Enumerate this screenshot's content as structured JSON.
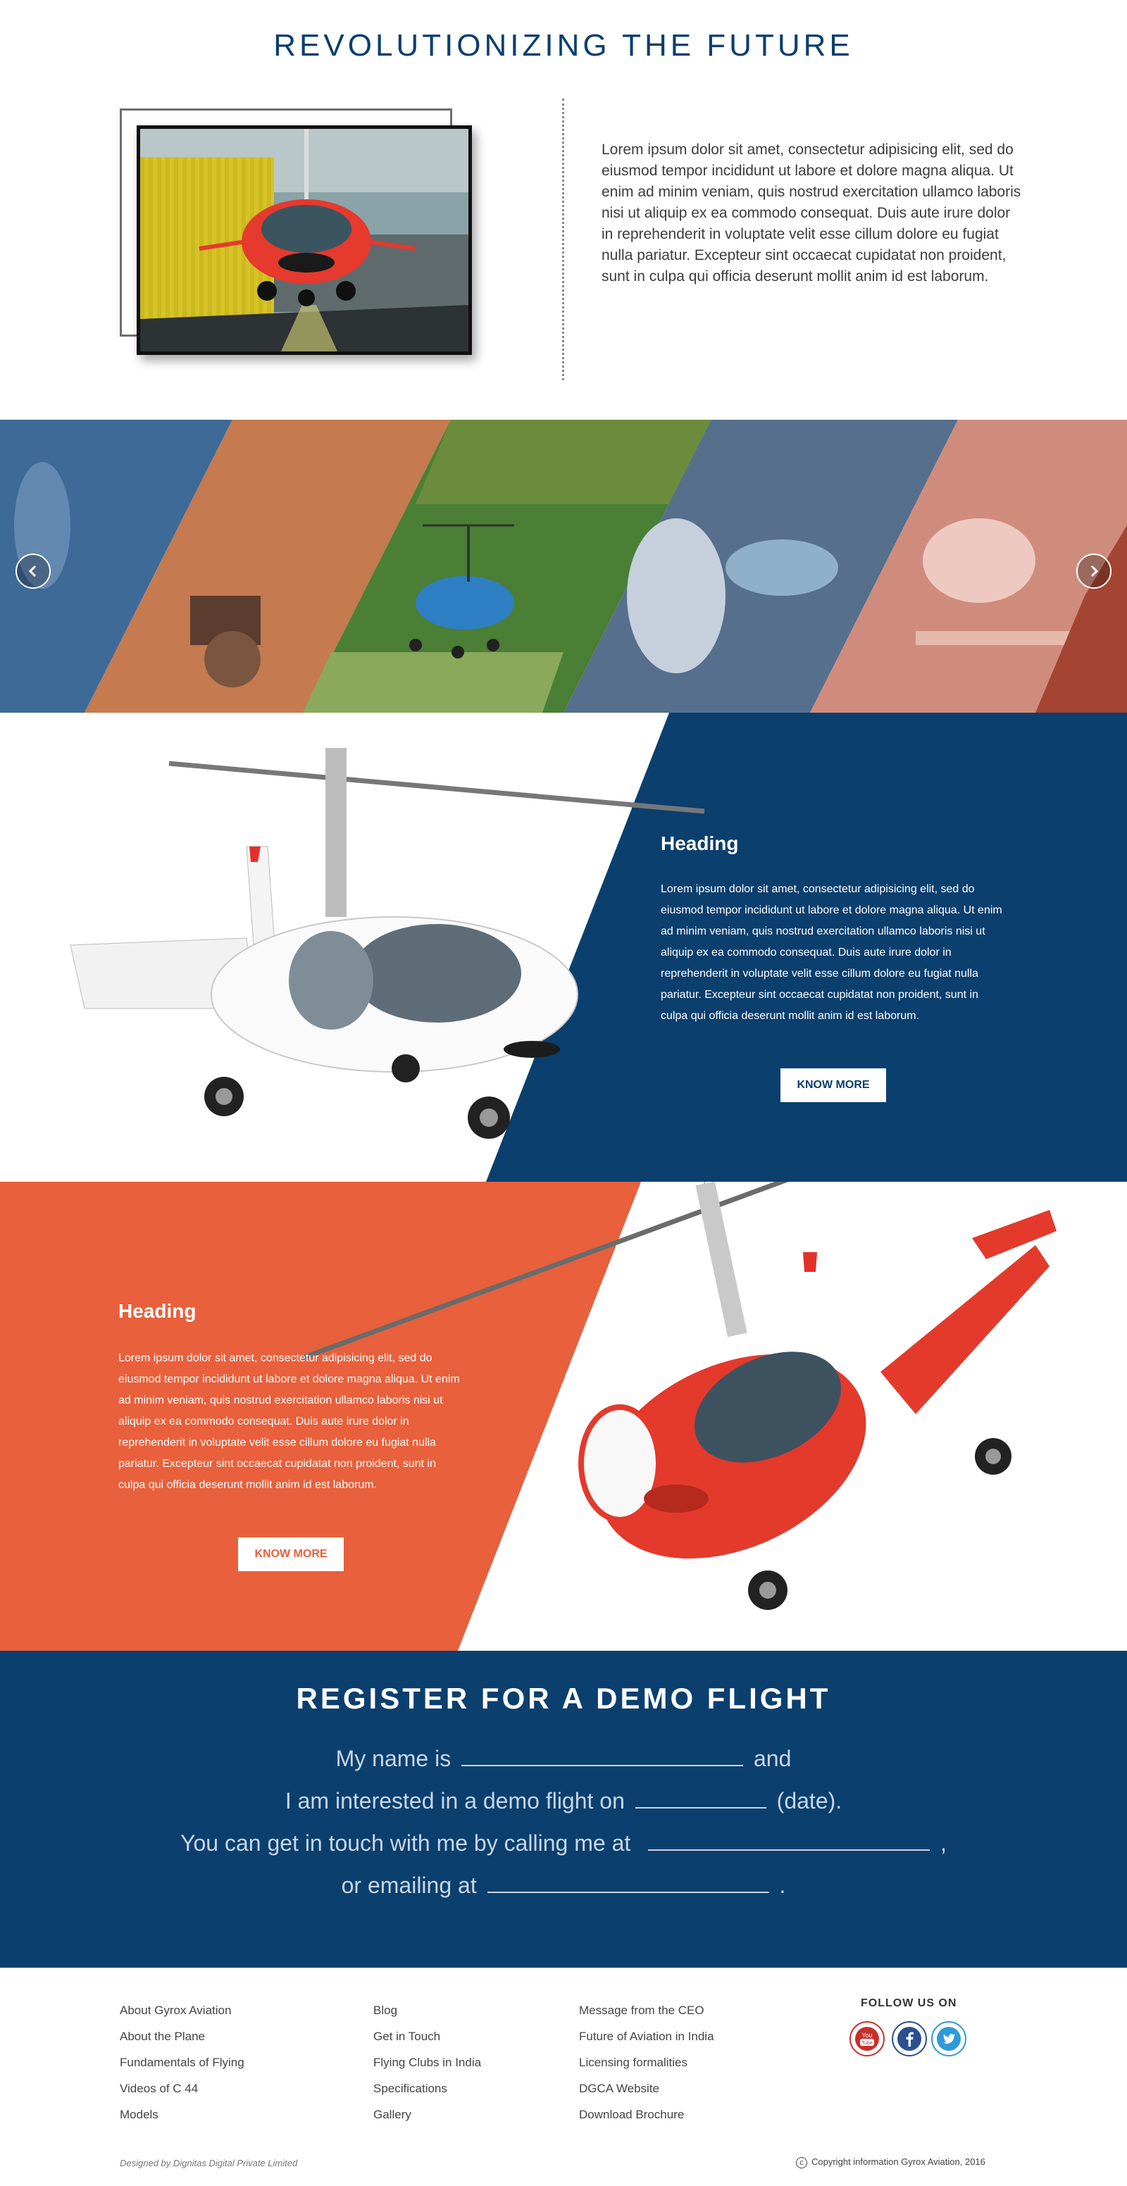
{
  "intro": {
    "title": "REVOLUTIONIZING THE FUTURE",
    "paragraph": "Lorem ipsum dolor sit amet, consectetur adipisicing elit, sed do eiusmod tempor incididunt ut labore et dolore magna aliqua. Ut enim ad minim veniam, quis nostrud exercitation ullamco laboris nisi ut aliquip ex ea commodo consequat. Duis aute irure dolor in reprehenderit in voluptate velit esse cillum dolore eu fugiat nulla pariatur. Excepteur sint occaecat cupidatat non proident, sunt in culpa qui officia deserunt mollit anim id est laborum."
  },
  "gallery": {
    "prev_icon": "chevron-left-icon",
    "next_icon": "chevron-right-icon"
  },
  "feature1": {
    "heading": "Heading",
    "text": "Lorem ipsum dolor sit amet, consectetur adipisicing elit, sed do eiusmod tempor incididunt ut labore et dolore magna aliqua. Ut enim ad minim veniam, quis nostrud exercitation ullamco laboris nisi ut aliquip ex ea commodo consequat. Duis aute irure dolor in reprehenderit in voluptate velit esse cillum dolore eu fugiat nulla pariatur. Excepteur sint occaecat cupidatat non proident, sunt in culpa qui officia deserunt mollit anim id est laborum.",
    "button": "KNOW MORE"
  },
  "feature2": {
    "heading": "Heading",
    "text": "Lorem ipsum dolor sit amet, consectetur adipisicing elit, sed do eiusmod tempor incididunt ut labore et dolore magna aliqua. Ut enim ad minim veniam, quis nostrud exercitation ullamco laboris nisi ut aliquip ex ea commodo consequat. Duis aute irure dolor in reprehenderit in voluptate velit esse cillum dolore eu fugiat nulla pariatur. Excepteur sint occaecat cupidatat non proident, sunt in culpa qui officia deserunt mollit anim id est laborum.",
    "button": "KNOW MORE"
  },
  "register": {
    "title": "REGISTER FOR A DEMO FLIGHT",
    "line1_a": "My name is",
    "line1_b": "and",
    "line2_a": "I am interested in a demo flight on",
    "line2_b": "(date).",
    "line3_a": "You can get in touch with me by calling me at",
    "line3_b": ",",
    "line4_a": "or emailing at",
    "line4_b": "."
  },
  "footer": {
    "col1": [
      "About Gyrox Aviation",
      "About the Plane",
      "Fundamentals of Flying",
      "Videos of C 44",
      "Models"
    ],
    "col2": [
      "Blog",
      "Get in Touch",
      "Flying Clubs in India",
      "Specifications",
      "Gallery"
    ],
    "col3": [
      "Message from the CEO",
      "Future of Aviation in India",
      "Licensing formalities",
      "DGCA Website",
      "Download Brochure"
    ],
    "follow": "FOLLOW US ON",
    "social_icons": [
      "youtube-icon",
      "facebook-icon",
      "twitter-icon"
    ],
    "designed_by": "Designed by Dignitas Digital Private Limited",
    "copyright": "Copyright information Gyrox Aviation, 2016"
  },
  "colors": {
    "navy": "#0b3f6e",
    "orange": "#e8603c",
    "white": "#ffffff"
  }
}
